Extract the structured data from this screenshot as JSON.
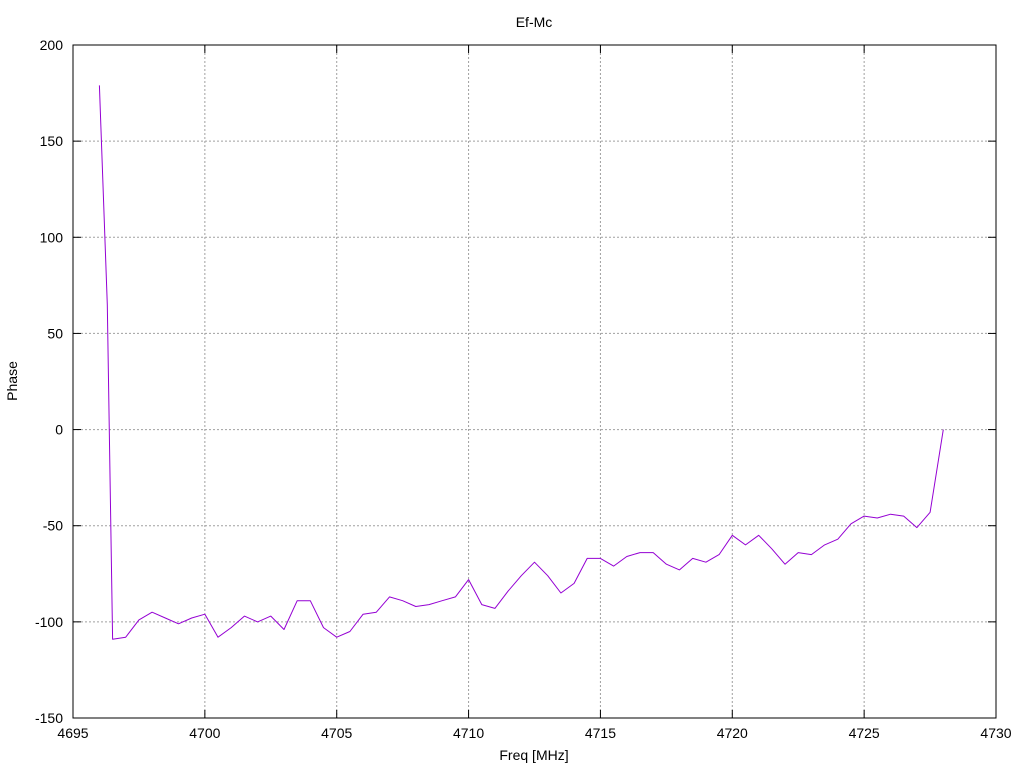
{
  "chart_data": {
    "type": "line",
    "title": "Ef-Mc",
    "xlabel": "Freq [MHz]",
    "ylabel": "Phase",
    "xlim": [
      4695,
      4730
    ],
    "ylim": [
      -150,
      200
    ],
    "xticks": [
      4695,
      4700,
      4705,
      4710,
      4715,
      4720,
      4725,
      4730
    ],
    "yticks": [
      -150,
      -100,
      -50,
      0,
      50,
      100,
      150,
      200
    ],
    "grid": true,
    "line_color": "#9400d3",
    "series": [
      {
        "points": [
          [
            4696.0,
            179
          ],
          [
            4696.3,
            65
          ],
          [
            4696.5,
            -109
          ],
          [
            4697.0,
            -108
          ],
          [
            4697.5,
            -99
          ],
          [
            4698.0,
            -95
          ],
          [
            4698.5,
            -98
          ],
          [
            4699.0,
            -101
          ],
          [
            4699.5,
            -98
          ],
          [
            4700.0,
            -96
          ],
          [
            4700.5,
            -108
          ],
          [
            4701.0,
            -103
          ],
          [
            4701.5,
            -97
          ],
          [
            4702.0,
            -100
          ],
          [
            4702.5,
            -97
          ],
          [
            4703.0,
            -104
          ],
          [
            4703.5,
            -89
          ],
          [
            4704.0,
            -89
          ],
          [
            4704.5,
            -103
          ],
          [
            4705.0,
            -108
          ],
          [
            4705.5,
            -105
          ],
          [
            4706.0,
            -96
          ],
          [
            4706.5,
            -95
          ],
          [
            4707.0,
            -87
          ],
          [
            4707.5,
            -89
          ],
          [
            4708.0,
            -92
          ],
          [
            4708.5,
            -91
          ],
          [
            4709.0,
            -89
          ],
          [
            4709.5,
            -87
          ],
          [
            4710.0,
            -78
          ],
          [
            4710.5,
            -91
          ],
          [
            4711.0,
            -93
          ],
          [
            4711.5,
            -84
          ],
          [
            4712.0,
            -76
          ],
          [
            4712.5,
            -69
          ],
          [
            4713.0,
            -76
          ],
          [
            4713.5,
            -85
          ],
          [
            4714.0,
            -80
          ],
          [
            4714.5,
            -67
          ],
          [
            4715.0,
            -67
          ],
          [
            4715.5,
            -71
          ],
          [
            4716.0,
            -66
          ],
          [
            4716.5,
            -64
          ],
          [
            4717.0,
            -64
          ],
          [
            4717.5,
            -70
          ],
          [
            4718.0,
            -73
          ],
          [
            4718.5,
            -67
          ],
          [
            4719.0,
            -69
          ],
          [
            4719.5,
            -65
          ],
          [
            4720.0,
            -55
          ],
          [
            4720.5,
            -60
          ],
          [
            4721.0,
            -55
          ],
          [
            4721.5,
            -62
          ],
          [
            4722.0,
            -70
          ],
          [
            4722.5,
            -64
          ],
          [
            4723.0,
            -65
          ],
          [
            4723.5,
            -60
          ],
          [
            4724.0,
            -57
          ],
          [
            4724.5,
            -49
          ],
          [
            4725.0,
            -45
          ],
          [
            4725.5,
            -46
          ],
          [
            4726.0,
            -44
          ],
          [
            4726.5,
            -45
          ],
          [
            4727.0,
            -51
          ],
          [
            4727.5,
            -43
          ],
          [
            4728.0,
            0
          ]
        ]
      }
    ]
  }
}
